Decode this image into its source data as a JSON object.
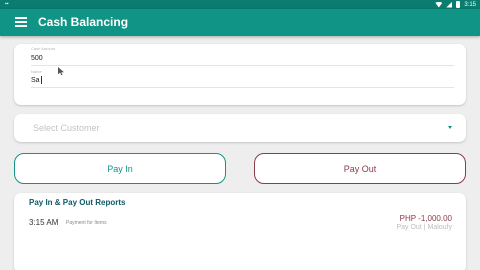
{
  "status_bar": {
    "left_icon": "sim-icon",
    "time": "3:15"
  },
  "app_bar": {
    "menu_icon": "menu-icon",
    "title": "Cash Balancing"
  },
  "form": {
    "amount": {
      "label": "Cash Amount",
      "value": "500"
    },
    "name": {
      "label": "Name",
      "value": "Sa"
    },
    "customer_select": {
      "placeholder": "Select Customer",
      "icon": "chevron-down-icon"
    }
  },
  "actions": {
    "pay_in_label": "Pay In",
    "pay_out_label": "Pay Out"
  },
  "reports": {
    "title": "Pay In & Pay Out Reports",
    "entries": [
      {
        "time": "3:15 AM",
        "description": "Payment for Items",
        "amount": "PHP -1,000.00",
        "method": "Pay Out | Maloufy"
      }
    ]
  },
  "colors": {
    "primary": "#0f9486",
    "status_bar": "#0b7d70",
    "pay_out": "#8b3a4a",
    "background": "#eeeeee"
  }
}
